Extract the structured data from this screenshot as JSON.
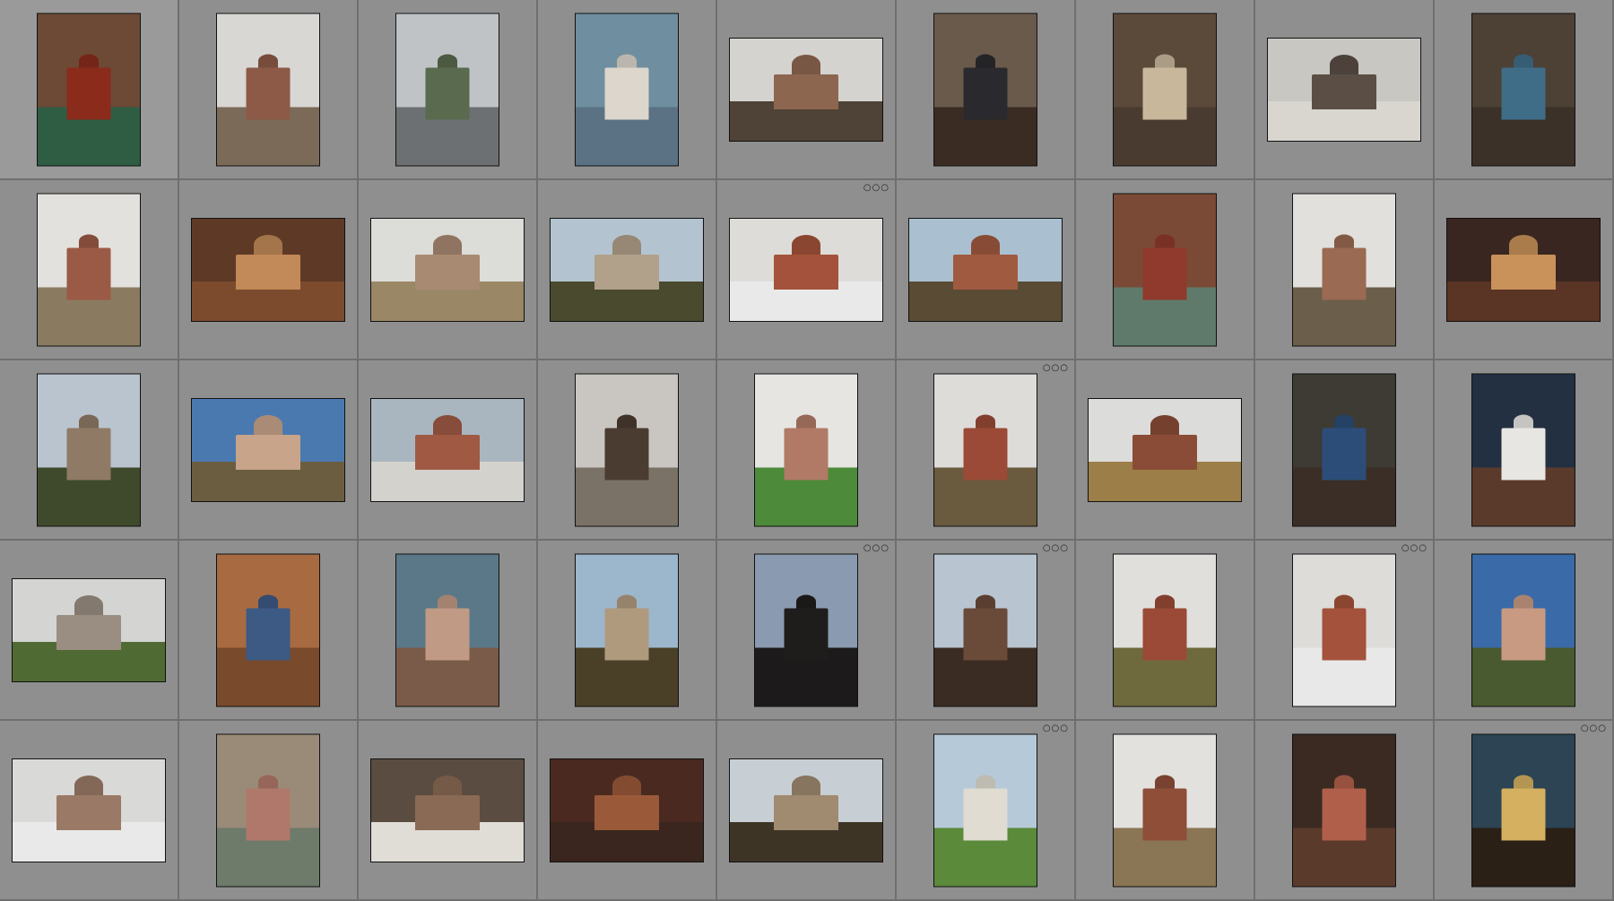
{
  "grid": {
    "columns": 9,
    "rows": 5,
    "items": [
      {
        "orientation": "portrait",
        "sky": "#6c4a35",
        "ground": "#2f5d43",
        "bldg": "#8a2b1c",
        "badge": ""
      },
      {
        "orientation": "portrait",
        "sky": "#d9d7d4",
        "ground": "#7c6a59",
        "bldg": "#8c5a47",
        "badge": ""
      },
      {
        "orientation": "portrait",
        "sky": "#bfc3c6",
        "ground": "#6c7072",
        "bldg": "#5a6a4e",
        "badge": ""
      },
      {
        "orientation": "portrait",
        "sky": "#6f8ea0",
        "ground": "#5a7283",
        "bldg": "#dcd6cc",
        "badge": ""
      },
      {
        "orientation": "landscape",
        "sky": "#d5d3cf",
        "ground": "#4f4236",
        "bldg": "#8d6650",
        "badge": ""
      },
      {
        "orientation": "portrait",
        "sky": "#6a5a4c",
        "ground": "#3a2c22",
        "bldg": "#2a2a2e",
        "badge": ""
      },
      {
        "orientation": "portrait",
        "sky": "#5b4a3a",
        "ground": "#4a3b30",
        "bldg": "#c9b79c",
        "badge": ""
      },
      {
        "orientation": "landscape",
        "sky": "#c8c7c2",
        "ground": "#d9d6d0",
        "bldg": "#5a4e45",
        "badge": ""
      },
      {
        "orientation": "portrait",
        "sky": "#4d4035",
        "ground": "#3b3128",
        "bldg": "#3f6d87",
        "badge": ""
      },
      {
        "orientation": "portrait",
        "sky": "#e3e1dd",
        "ground": "#8a7b60",
        "bldg": "#9b5a45",
        "badge": ""
      },
      {
        "orientation": "landscape",
        "sky": "#5e3a26",
        "ground": "#7c4b2e",
        "bldg": "#c18a58",
        "badge": ""
      },
      {
        "orientation": "landscape",
        "sky": "#dcdcd8",
        "ground": "#9a8766",
        "bldg": "#a88a72",
        "badge": ""
      },
      {
        "orientation": "landscape",
        "sky": "#b3c4d0",
        "ground": "#4a4a2e",
        "bldg": "#b1a08a",
        "badge": ""
      },
      {
        "orientation": "landscape",
        "sky": "#dedcd8",
        "ground": "#e9e9e9",
        "bldg": "#a4523b",
        "badge": "○○○"
      },
      {
        "orientation": "landscape",
        "sky": "#aac0d0",
        "ground": "#5a4c34",
        "bldg": "#a05a40",
        "badge": ""
      },
      {
        "orientation": "portrait",
        "sky": "#7a4a36",
        "ground": "#5f7a6a",
        "bldg": "#8f3a2c",
        "badge": ""
      },
      {
        "orientation": "portrait",
        "sky": "#e1e0dd",
        "ground": "#6b5e4a",
        "bldg": "#9a6a52",
        "badge": ""
      },
      {
        "orientation": "landscape",
        "sky": "#3a2620",
        "ground": "#5a3424",
        "bldg": "#c8925a",
        "badge": ""
      },
      {
        "orientation": "portrait",
        "sky": "#b9c4cf",
        "ground": "#3f4a2c",
        "bldg": "#8f7a66",
        "badge": ""
      },
      {
        "orientation": "landscape",
        "sky": "#4a79b0",
        "ground": "#6b5e40",
        "bldg": "#c8a48a",
        "badge": ""
      },
      {
        "orientation": "landscape",
        "sky": "#a9b6c0",
        "ground": "#d4d2cc",
        "bldg": "#a05a44",
        "badge": ""
      },
      {
        "orientation": "portrait",
        "sky": "#c9c6c2",
        "ground": "#7a7266",
        "bldg": "#4a3c30",
        "badge": ""
      },
      {
        "orientation": "portrait",
        "sky": "#e7e5e2",
        "ground": "#4d8a3a",
        "bldg": "#b07a66",
        "badge": ""
      },
      {
        "orientation": "portrait",
        "sky": "#dddcd9",
        "ground": "#6a5a3e",
        "bldg": "#9a4a36",
        "badge": "○○○"
      },
      {
        "orientation": "landscape",
        "sky": "#dcdcda",
        "ground": "#9c7e48",
        "bldg": "#8a4c36",
        "badge": ""
      },
      {
        "orientation": "portrait",
        "sky": "#3e3a34",
        "ground": "#3a2e26",
        "bldg": "#2c4d78",
        "badge": ""
      },
      {
        "orientation": "portrait",
        "sky": "#223042",
        "ground": "#5a3a2a",
        "bldg": "#e8e6e2",
        "badge": ""
      },
      {
        "orientation": "landscape",
        "sky": "#d4d5d2",
        "ground": "#506a34",
        "bldg": "#9a8e82",
        "badge": ""
      },
      {
        "orientation": "portrait",
        "sky": "#a86a40",
        "ground": "#7a4a2c",
        "bldg": "#3c5a84",
        "badge": ""
      },
      {
        "orientation": "portrait",
        "sky": "#5a7888",
        "ground": "#7a5a48",
        "bldg": "#c09a84",
        "badge": ""
      },
      {
        "orientation": "portrait",
        "sky": "#9cb6cc",
        "ground": "#4a4028",
        "bldg": "#b09a7e",
        "badge": ""
      },
      {
        "orientation": "portrait",
        "sky": "#8a9ab0",
        "ground": "#1c1a1a",
        "bldg": "#1f1d1c",
        "badge": "○○○"
      },
      {
        "orientation": "portrait",
        "sky": "#b8c4d0",
        "ground": "#3a2c22",
        "bldg": "#6a4a38",
        "badge": "○○○"
      },
      {
        "orientation": "portrait",
        "sky": "#e0dfdc",
        "ground": "#6e6a3e",
        "bldg": "#9a4a36",
        "badge": ""
      },
      {
        "orientation": "portrait",
        "sky": "#dddcd9",
        "ground": "#e8e8e8",
        "bldg": "#a4523b",
        "badge": "○○○"
      },
      {
        "orientation": "portrait",
        "sky": "#3a6aa8",
        "ground": "#4a5a30",
        "bldg": "#c89a82",
        "badge": ""
      },
      {
        "orientation": "landscape",
        "sky": "#d9d9d7",
        "ground": "#e9e9e9",
        "bldg": "#9a7a66",
        "badge": ""
      },
      {
        "orientation": "portrait",
        "sky": "#9a8a78",
        "ground": "#6e7a6a",
        "bldg": "#b0786a",
        "badge": ""
      },
      {
        "orientation": "landscape",
        "sky": "#5a4c40",
        "ground": "#e0dcd6",
        "bldg": "#8a6a54",
        "badge": ""
      },
      {
        "orientation": "landscape",
        "sky": "#4a2a20",
        "ground": "#3a261e",
        "bldg": "#9a5a3a",
        "badge": ""
      },
      {
        "orientation": "landscape",
        "sky": "#c8cfd4",
        "ground": "#3e3426",
        "bldg": "#a08a70",
        "badge": ""
      },
      {
        "orientation": "portrait",
        "sky": "#b6c9d8",
        "ground": "#5a8a3a",
        "bldg": "#e0dcd2",
        "badge": "○○○"
      },
      {
        "orientation": "portrait",
        "sky": "#e2e1de",
        "ground": "#8a7654",
        "bldg": "#8e4e38",
        "badge": ""
      },
      {
        "orientation": "portrait",
        "sky": "#3a2a22",
        "ground": "#5a3a2a",
        "bldg": "#b0604a",
        "badge": ""
      },
      {
        "orientation": "portrait",
        "sky": "#2c4454",
        "ground": "#2a2016",
        "bldg": "#d4b060",
        "badge": "○○○"
      }
    ]
  }
}
